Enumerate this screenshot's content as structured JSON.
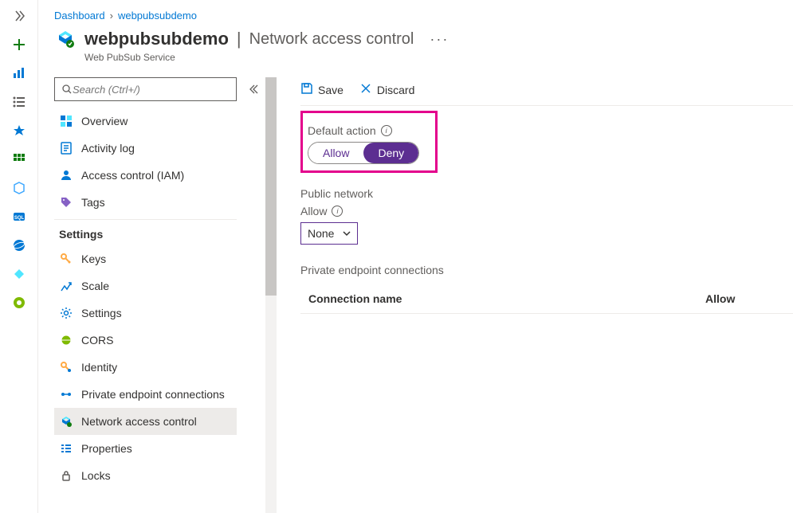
{
  "breadcrumb": {
    "root": "Dashboard",
    "current": "webpubsubdemo"
  },
  "header": {
    "resource_name": "webpubsubdemo",
    "page_title": "Network access control",
    "resource_type": "Web PubSub Service",
    "more": "···"
  },
  "search": {
    "placeholder": "Search (Ctrl+/)"
  },
  "nav": {
    "top": [
      {
        "label": "Overview",
        "icon": "overview"
      },
      {
        "label": "Activity log",
        "icon": "activitylog"
      },
      {
        "label": "Access control (IAM)",
        "icon": "iam"
      },
      {
        "label": "Tags",
        "icon": "tags"
      }
    ],
    "settings_label": "Settings",
    "settings": [
      {
        "label": "Keys",
        "icon": "keys"
      },
      {
        "label": "Scale",
        "icon": "scale"
      },
      {
        "label": "Settings",
        "icon": "settings"
      },
      {
        "label": "CORS",
        "icon": "cors"
      },
      {
        "label": "Identity",
        "icon": "identity"
      },
      {
        "label": "Private endpoint connections",
        "icon": "pec"
      },
      {
        "label": "Network access control",
        "icon": "nac",
        "selected": true
      },
      {
        "label": "Properties",
        "icon": "properties"
      },
      {
        "label": "Locks",
        "icon": "locks"
      }
    ]
  },
  "toolbar": {
    "save_label": "Save",
    "discard_label": "Discard"
  },
  "detail": {
    "default_action_label": "Default action",
    "default_action": {
      "allow_label": "Allow",
      "deny_label": "Deny",
      "selected": "Deny"
    },
    "public_network_label": "Public network",
    "allow_label": "Allow",
    "allow_value": "None",
    "pec_label": "Private endpoint connections",
    "table": {
      "col_name": "Connection name",
      "col_allow": "Allow"
    }
  },
  "colors": {
    "accent": "#0078d4",
    "highlight": "#e3008c",
    "toggle_active": "#5c2e91"
  }
}
